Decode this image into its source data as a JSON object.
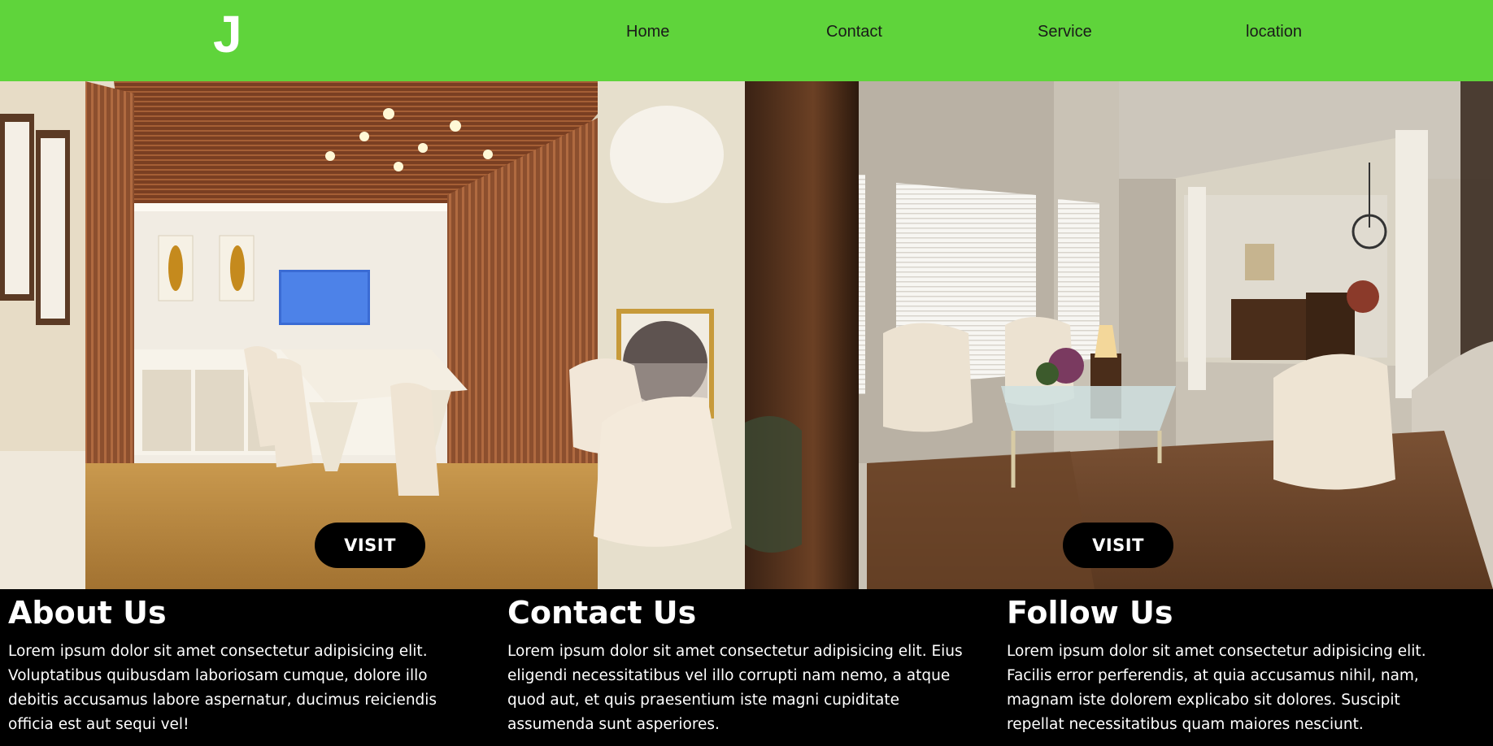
{
  "navbar": {
    "logo": "J",
    "links": [
      "Home",
      "Contact",
      "Service",
      "location"
    ],
    "background": "#5fd43b"
  },
  "hero": {
    "left_image": "office-interior-image",
    "right_image": "living-room-image",
    "visit_label": "VISIT"
  },
  "footer": {
    "about": {
      "title": "About Us",
      "text": "Lorem ipsum dolor sit amet consectetur adipisicing elit. Voluptatibus quibusdam laboriosam cumque, dolore illo debitis accusamus labore aspernatur, ducimus reiciendis officia est aut sequi vel!"
    },
    "contact": {
      "title": "Contact Us",
      "text": "Lorem ipsum dolor sit amet consectetur adipisicing elit. Eius eligendi necessitatibus vel illo corrupti nam nemo, a atque quod aut, et quis praesentium iste magni cupiditate assumenda sunt asperiores."
    },
    "follow": {
      "title": "Follow Us",
      "text": "Lorem ipsum dolor sit amet consectetur adipisicing elit. Facilis error perferendis, at quia accusamus nihil, nam, magnam iste dolorem explicabo sit dolores. Suscipit repellat necessitatibus quam maiores nesciunt."
    }
  }
}
